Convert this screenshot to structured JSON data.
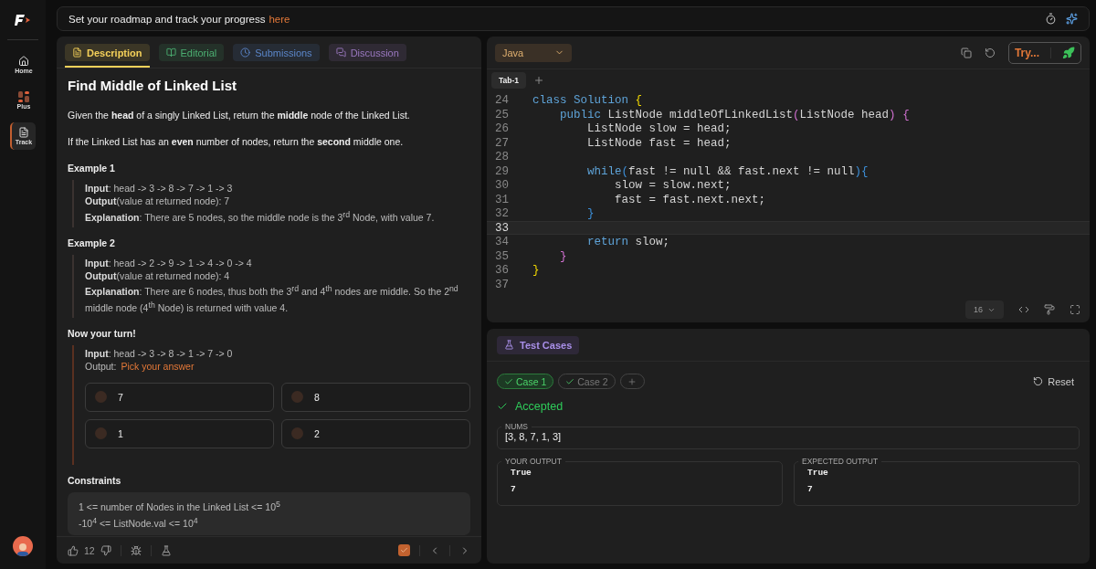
{
  "sidebar": {
    "items": [
      {
        "label": "Home",
        "selected": false
      },
      {
        "label": "Plus",
        "selected": false
      },
      {
        "label": "Track",
        "selected": true
      }
    ]
  },
  "banner": {
    "text": "Set your roadmap and track your progress",
    "link": "here"
  },
  "tabs": [
    {
      "label": "Description",
      "color": "#f5d15a",
      "selected": true
    },
    {
      "label": "Editorial",
      "color": "#4caf72",
      "selected": false
    },
    {
      "label": "Submissions",
      "color": "#5b86c9",
      "selected": false
    },
    {
      "label": "Discussion",
      "color": "#9a78c0",
      "selected": false
    }
  ],
  "problem": {
    "title": "Find Middle of Linked List",
    "paragraphs": [
      "Given the **head** of a singly Linked List, return the **middle** node of the Linked List.",
      "If the Linked List has an **even** number of nodes, return the **second** middle one."
    ],
    "examples": [
      {
        "heading": "Example 1",
        "lines": [
          "**Input**: head -> 3 -> 8 -> 7 -> 1 -> 3",
          "**Output**(value at returned node): 7",
          "**Explanation**: There are 5 nodes, so the middle node is the 3$^{rd}$ Node, with value 7."
        ]
      },
      {
        "heading": "Example 2",
        "lines": [
          "**Input**: head -> 2 -> 9 -> 1 -> 4 -> 0 -> 4",
          "**Output**(value at returned node): 4",
          "**Explanation**: There are 6 nodes, thus both the 3$^{rd}$ and 4$^{th}$ nodes are middle. So the 2$^{nd}$ middle node (4$^{th}$ Node) is returned with value 4."
        ]
      }
    ],
    "quiz": {
      "heading": "Now your turn!",
      "input": "**Input**: head -> 3 -> 8 -> 1 -> 7 -> 0",
      "output_label": "Output:",
      "prompt": "Pick your answer",
      "options": [
        {
          "label": "7",
          "selected": false
        },
        {
          "label": "8",
          "selected": false
        },
        {
          "label": "1",
          "selected": false
        },
        {
          "label": "2",
          "selected": false
        }
      ]
    },
    "constraints": {
      "heading": "Constraints",
      "lines": [
        "1 <= number of Nodes in the Linked List <= 10$^{5}$",
        "-10$^{4}$ <= ListNode.val <= 10$^{4}$"
      ]
    }
  },
  "footer": {
    "likes": "12",
    "done": true
  },
  "editor": {
    "language": "Java",
    "run_label": "Try...",
    "tabs": [
      {
        "label": "Tab-1",
        "selected": true
      }
    ],
    "font_size": "16",
    "lines": [
      {
        "number": "24",
        "current": false,
        "tokens": [
          {
            "text": "class Solution ",
            "kind": "keyword"
          },
          {
            "text": "{",
            "kind": "brace1"
          }
        ]
      },
      {
        "number": "25",
        "current": false,
        "tokens": [
          {
            "text": "    public ",
            "kind": "keyword"
          },
          {
            "text": "ListNode middleOfLinkedList",
            "kind": "plain"
          },
          {
            "text": "(",
            "kind": "brace2"
          },
          {
            "text": "ListNode head",
            "kind": "plain"
          },
          {
            "text": ")",
            "kind": "brace2"
          },
          {
            "text": " {",
            "kind": "brace2"
          }
        ]
      },
      {
        "number": "26",
        "current": false,
        "tokens": [
          {
            "text": "        ListNode slow = head;",
            "kind": "plain"
          }
        ]
      },
      {
        "number": "27",
        "current": false,
        "tokens": [
          {
            "text": "        ListNode fast = head;",
            "kind": "plain"
          }
        ]
      },
      {
        "number": "28",
        "current": false
      },
      {
        "number": "29",
        "current": false,
        "tokens": [
          {
            "text": "        while",
            "kind": "keyword"
          },
          {
            "text": "(",
            "kind": "brace3"
          },
          {
            "text": "fast != null && fast.next != null",
            "kind": "plain"
          },
          {
            "text": "){",
            "kind": "brace3"
          }
        ]
      },
      {
        "number": "30",
        "current": false,
        "tokens": [
          {
            "text": "            slow = slow.next;",
            "kind": "plain"
          }
        ]
      },
      {
        "number": "31",
        "current": false,
        "tokens": [
          {
            "text": "            fast = fast.next.next;",
            "kind": "plain"
          }
        ]
      },
      {
        "number": "32",
        "current": false,
        "tokens": [
          {
            "text": "        }",
            "kind": "brace3"
          }
        ]
      },
      {
        "number": "33",
        "current": true
      },
      {
        "number": "34",
        "current": false,
        "tokens": [
          {
            "text": "        return ",
            "kind": "keyword"
          },
          {
            "text": "slow;",
            "kind": "plain"
          }
        ]
      },
      {
        "number": "35",
        "current": false,
        "tokens": [
          {
            "text": "    }",
            "kind": "brace2"
          }
        ]
      },
      {
        "number": "36",
        "current": false,
        "tokens": [
          {
            "text": "}",
            "kind": "brace1"
          }
        ]
      },
      {
        "number": "37",
        "current": false
      }
    ]
  },
  "tests": {
    "tab": "Test Cases",
    "cases": [
      {
        "label": "Case 1",
        "selected": true,
        "passed": true
      },
      {
        "label": "Case 2",
        "selected": false,
        "passed": true
      }
    ],
    "reset": "Reset",
    "status": "Accepted",
    "accepted": true,
    "input": {
      "label": "NUMS",
      "value": "[3, 8, 7, 1, 3]"
    },
    "outputs": [
      {
        "label": "YOUR OUTPUT",
        "lines": [
          "True",
          "7"
        ]
      },
      {
        "label": "EXPECTED OUTPUT",
        "lines": [
          "True",
          "7"
        ]
      }
    ]
  }
}
